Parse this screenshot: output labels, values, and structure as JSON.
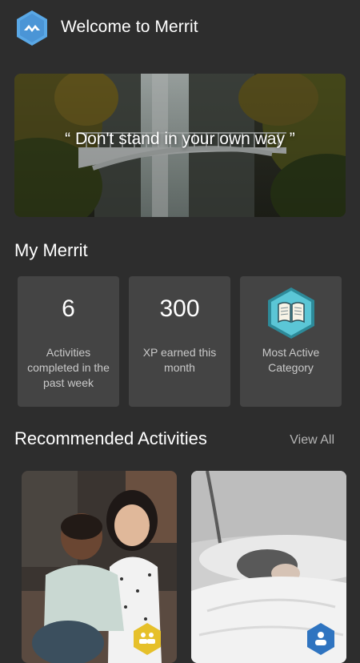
{
  "header": {
    "title": "Welcome to Merrit",
    "logo_icon": "merrit-logo-icon"
  },
  "hero": {
    "quote": "“ Don't stand in your own way ”"
  },
  "my_merrit": {
    "title": "My Merrit",
    "stats": [
      {
        "value": "6",
        "label": "Activities completed in the past week"
      },
      {
        "value": "300",
        "label": "XP earned this month"
      },
      {
        "value": "",
        "label": "Most Active Category",
        "icon": "book-badge-icon"
      }
    ]
  },
  "recommended": {
    "title": "Recommended Activities",
    "view_all": "View All",
    "cards": [
      {
        "icon": "group-badge-icon",
        "badge_color": "#e6c02a"
      },
      {
        "icon": "person-badge-icon",
        "badge_color": "#2f74c0"
      }
    ]
  }
}
